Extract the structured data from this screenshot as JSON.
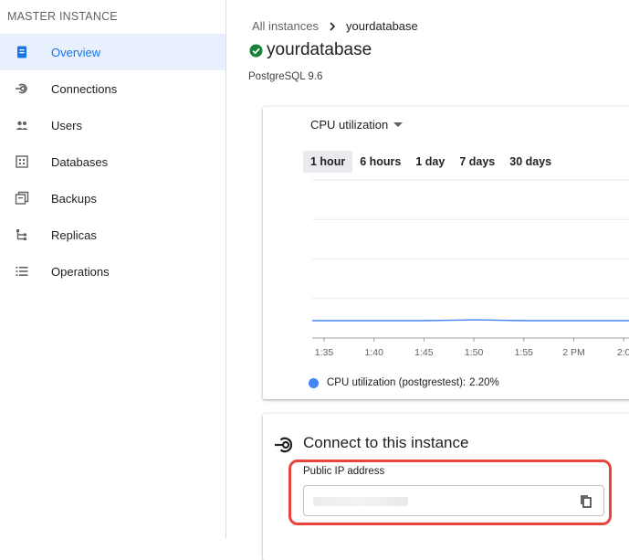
{
  "sidebar": {
    "header": "MASTER INSTANCE",
    "items": [
      {
        "label": "Overview",
        "icon": "overview-doc-icon",
        "active": true
      },
      {
        "label": "Connections",
        "icon": "connection-icon",
        "active": false
      },
      {
        "label": "Users",
        "icon": "users-icon",
        "active": false
      },
      {
        "label": "Databases",
        "icon": "database-grid-icon",
        "active": false
      },
      {
        "label": "Backups",
        "icon": "backup-icon",
        "active": false
      },
      {
        "label": "Replicas",
        "icon": "replica-icon",
        "active": false
      },
      {
        "label": "Operations",
        "icon": "list-icon",
        "active": false
      }
    ]
  },
  "breadcrumb": {
    "parent": "All instances",
    "current": "yourdatabase"
  },
  "instance": {
    "name": "yourdatabase",
    "version": "PostgreSQL 9.6",
    "status": "running"
  },
  "chart": {
    "metric_label": "CPU utilization",
    "ranges": [
      {
        "label": "1 hour",
        "active": true
      },
      {
        "label": "6 hours",
        "active": false
      },
      {
        "label": "1 day",
        "active": false
      },
      {
        "label": "7 days",
        "active": false
      },
      {
        "label": "30 days",
        "active": false
      }
    ],
    "legend": "CPU utilization (postgrestest):",
    "legend_value": "2.20%"
  },
  "chart_data": {
    "type": "line",
    "x": [
      "1:35",
      "1:40",
      "1:45",
      "1:50",
      "1:55",
      "2 PM",
      "2:0"
    ],
    "series": [
      {
        "name": "CPU utilization (postgrestest)",
        "values": [
          2.2,
          2.2,
          2.2,
          2.3,
          2.2,
          2.2,
          2.2
        ]
      }
    ],
    "ylim": [
      0,
      20
    ],
    "grid": true,
    "color": "#4285f4"
  },
  "connect": {
    "title": "Connect to this instance",
    "ip_label": "Public IP address",
    "ip_value": ""
  },
  "colors": {
    "accent": "#1a73e8",
    "active_bg": "#e8f0fe",
    "highlight": "#e8453c",
    "status_green": "#188038"
  }
}
